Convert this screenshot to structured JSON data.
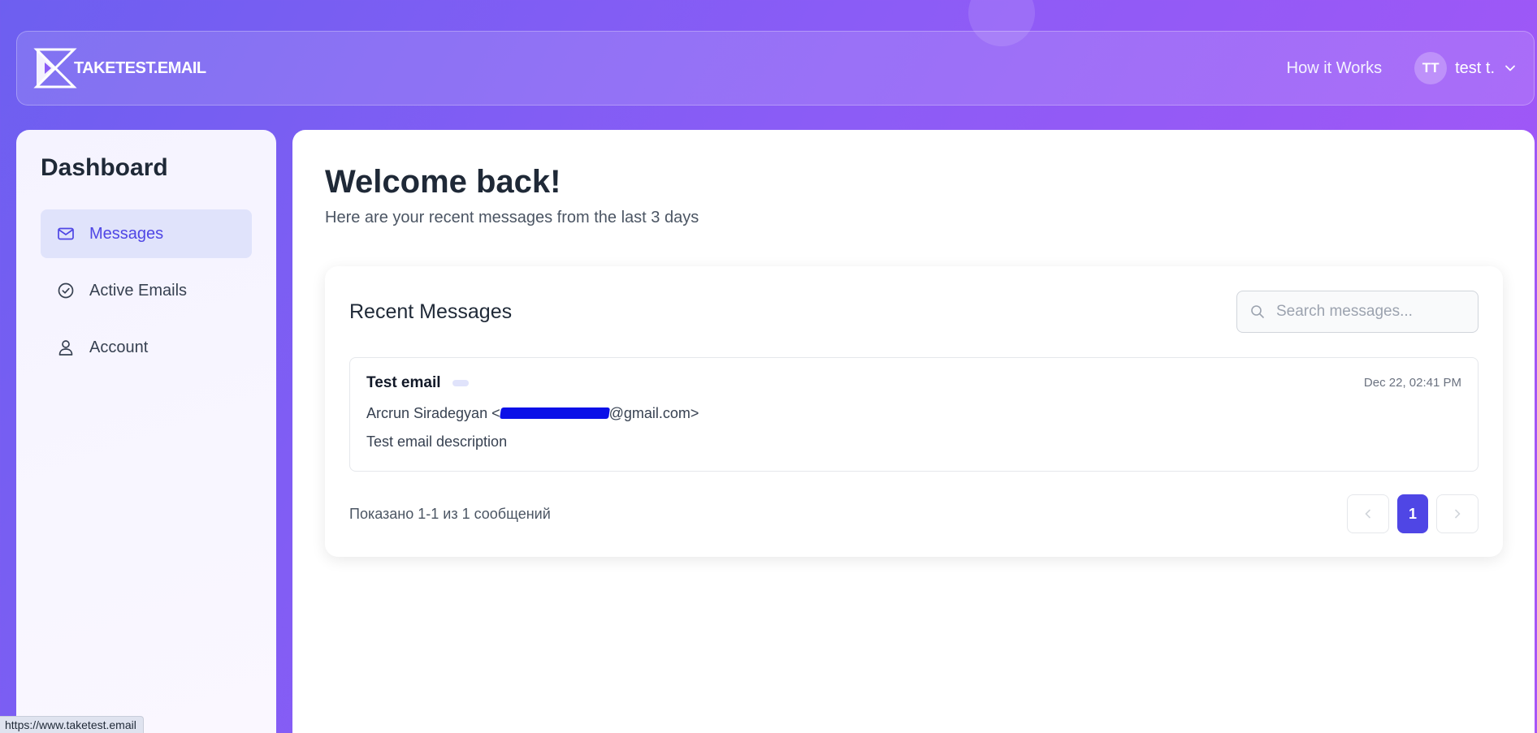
{
  "header": {
    "logo_text": "TAKETEST.EMAIL",
    "nav_how": "How it Works",
    "user_initials": "TT",
    "user_name": "test t."
  },
  "sidebar": {
    "title": "Dashboard",
    "items": [
      {
        "label": "Messages",
        "icon": "mail-icon",
        "active": true
      },
      {
        "label": "Active Emails",
        "icon": "check-circle-icon",
        "active": false
      },
      {
        "label": "Account",
        "icon": "user-icon",
        "active": false
      }
    ]
  },
  "main": {
    "welcome": "Welcome back!",
    "subtitle": "Here are your recent messages from the last 3 days"
  },
  "messages_card": {
    "title": "Recent Messages",
    "search_placeholder": "Search messages...",
    "messages": [
      {
        "subject": "Test email",
        "date": "Dec 22, 02:41 PM",
        "from_name": "Arcrun Siradegyan <",
        "from_domain": "@gmail.com>",
        "description": "Test email description"
      }
    ],
    "count_text": "Показано 1-1 из 1 сообщений",
    "current_page": "1"
  },
  "status_url": "https://www.taketest.email",
  "colors": {
    "accent": "#4f46e5",
    "active_bg": "#e0e3fb",
    "bg_gradient_start": "#6d5ff0",
    "bg_gradient_end": "#a855f7"
  }
}
